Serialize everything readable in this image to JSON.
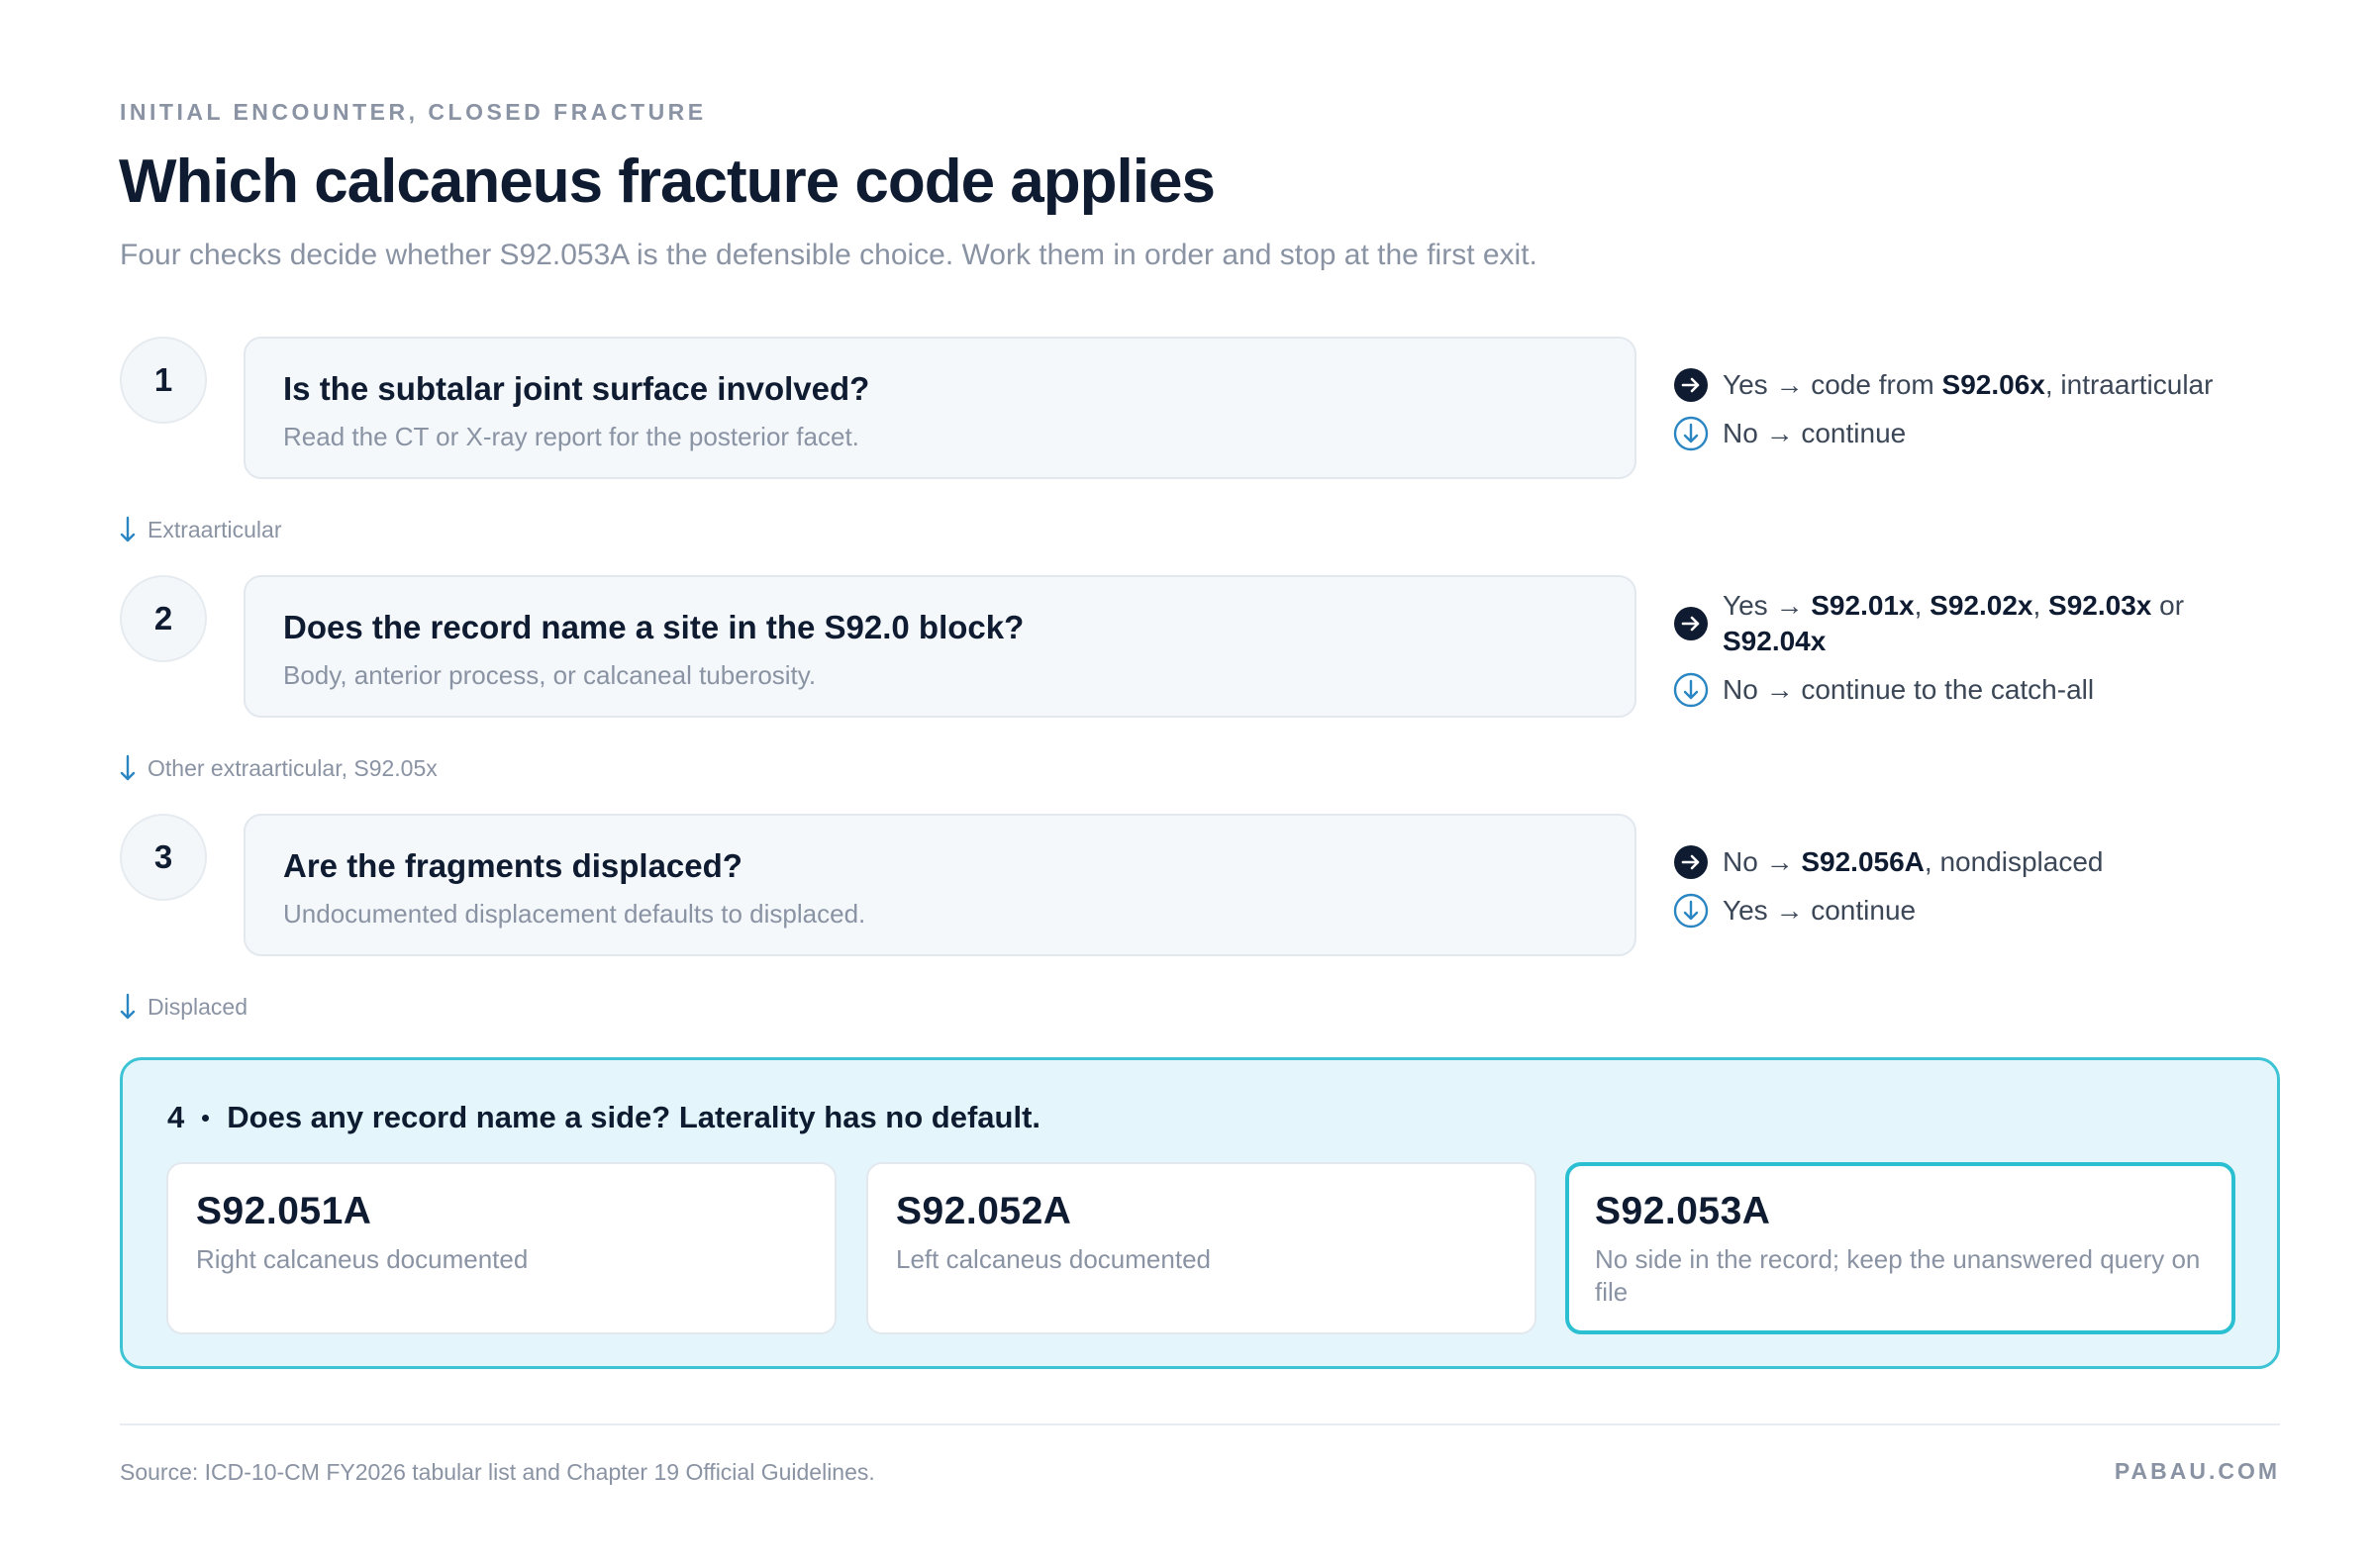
{
  "header": {
    "eyebrow": "INITIAL ENCOUNTER, CLOSED FRACTURE",
    "title": "Which calcaneus fracture code applies",
    "subtitle": "Four checks decide whether S92.053A is the defensible choice. Work them in order and stop at the first exit."
  },
  "steps": [
    {
      "number": "1",
      "question": "Is the subtalar joint surface involved?",
      "hint": "Read the CT or X-ray report for the posterior facet.",
      "exit": {
        "prefix": "Yes → code from ",
        "code": "S92.06x",
        "suffix": ", intraarticular"
      },
      "continue": "No → continue",
      "connector": "Extraarticular"
    },
    {
      "number": "2",
      "question": "Does the record name a site in the S92.0 block?",
      "hint": "Body, anterior process, or calcaneal tuberosity.",
      "exit": {
        "prefix": "Yes → ",
        "code1": "S92.01x",
        "sep1": ", ",
        "code2": "S92.02x",
        "sep2": ", ",
        "code3": "S92.03x",
        "sep3": " or ",
        "code4": "S92.04x"
      },
      "continue": "No → continue to the catch-all",
      "connector": "Other extraarticular, S92.05x"
    },
    {
      "number": "3",
      "question": "Are the fragments displaced?",
      "hint": "Undocumented displacement defaults to displaced.",
      "exit": {
        "prefix": "No → ",
        "code": "S92.056A",
        "suffix": ", nondisplaced"
      },
      "continue": "Yes → continue",
      "connector": "Displaced"
    }
  ],
  "final": {
    "number": "4",
    "question": "Does any record name a side? Laterality has no default.",
    "options": [
      {
        "code": "S92.051A",
        "desc": "Right calcaneus documented"
      },
      {
        "code": "S92.052A",
        "desc": "Left calcaneus documented"
      },
      {
        "code": "S92.053A",
        "desc": "No side in the record; keep the unanswered query on file",
        "selected": true
      }
    ]
  },
  "footer": {
    "source": "Source: ICD-10-CM FY2026 tabular list and Chapter 19 Official Guidelines.",
    "brand": "PABAU.COM"
  },
  "icons": {
    "exit": "arrow-right-circle-icon",
    "continue": "arrow-down-circle-icon",
    "connector": "arrow-down-icon"
  },
  "colors": {
    "ink": "#0f1b30",
    "muted": "#8a93a3",
    "accent": "#2bbfd2",
    "continue_icon": "#2a86c2"
  }
}
